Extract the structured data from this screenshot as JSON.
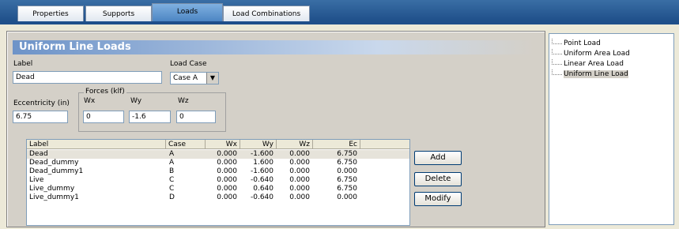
{
  "tabs": [
    "Properties",
    "Supports",
    "Loads",
    "Load Combinations"
  ],
  "active_tab": "Loads",
  "heading": "Uniform Line Loads",
  "label_field": {
    "label": "Label",
    "value": "Dead"
  },
  "load_case": {
    "label": "Load Case",
    "value": "Case A"
  },
  "eccentricity": {
    "label": "Eccentricity (in)",
    "value": "6.75"
  },
  "forces": {
    "title": "Forces (klf)",
    "wx": {
      "label": "Wx",
      "value": "0"
    },
    "wy": {
      "label": "Wy",
      "value": "-1.6"
    },
    "wz": {
      "label": "Wz",
      "value": "0"
    }
  },
  "table": {
    "headers": [
      "Label",
      "Case",
      "Wx",
      "Wy",
      "Wz",
      "Ec"
    ],
    "rows": [
      [
        "Dead",
        "A",
        "0.000",
        "-1.600",
        "0.000",
        "6.750"
      ],
      [
        "Dead_dummy",
        "A",
        "0.000",
        "1.600",
        "0.000",
        "6.750"
      ],
      [
        "Dead_dummy1",
        "B",
        "0.000",
        "-1.600",
        "0.000",
        "0.000"
      ],
      [
        "Live",
        "C",
        "0.000",
        "-0.640",
        "0.000",
        "6.750"
      ],
      [
        "Live_dummy",
        "C",
        "0.000",
        "0.640",
        "0.000",
        "6.750"
      ],
      [
        "Live_dummy1",
        "D",
        "0.000",
        "-0.640",
        "0.000",
        "0.000"
      ]
    ]
  },
  "buttons": {
    "add": "Add",
    "delete": "Delete",
    "modify": "Modify"
  },
  "tree": [
    "Point Load",
    "Uniform Area Load",
    "Linear Area Load",
    "Uniform Line Load"
  ],
  "tree_selected": "Uniform Line Load",
  "colors": {
    "accent": "#1f4f8a",
    "heading": "#6d93c8"
  }
}
